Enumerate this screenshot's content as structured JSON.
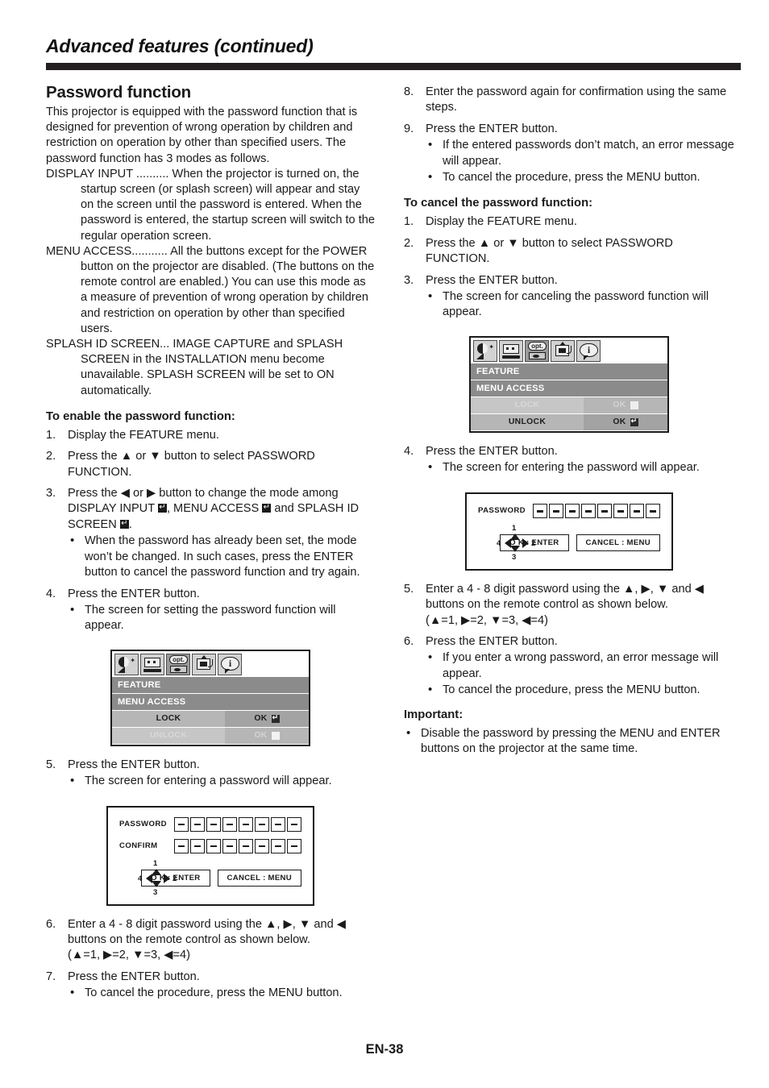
{
  "header": {
    "title": "Advanced features (continued)"
  },
  "left": {
    "section_title": "Password function",
    "intro": "This projector is equipped with the password function that is designed for prevention of wrong operation by children and restriction on operation by other than specified users. The password function has 3 modes as follows.",
    "modes": [
      {
        "lead": "DISPLAY INPUT ..........",
        "text": " When the projector is turned on, the startup screen (or splash screen) will appear and stay on the screen until the password is entered. When the password is entered, the startup screen will switch to the regular operation screen."
      },
      {
        "lead": "MENU ACCESS...........",
        "text": " All the buttons except for the POWER button on the projector are disabled. (The buttons on the remote control are enabled.) You can use this mode as a measure of prevention of wrong operation by children and restriction on operation by other than specified users."
      },
      {
        "lead": "SPLASH ID SCREEN...",
        "text": " IMAGE CAPTURE and SPLASH SCREEN in the INSTALLATION menu become unavailable. SPLASH SCREEN will be set to ON automatically."
      }
    ],
    "enable_title": "To enable the password function:",
    "steps": [
      {
        "num": "1.",
        "text": "Display the FEATURE menu."
      },
      {
        "num": "2.",
        "text": "Press the ▲ or ▼ button to select PASSWORD FUNCTION."
      },
      {
        "num": "3.",
        "text_a": "Press the ◀ or ▶ button to change the mode among DISPLAY INPUT ",
        "text_b": ", MENU ACCESS ",
        "text_c": " and SPLASH ID SCREEN ",
        "text_d": ".",
        "bullets": [
          "When the password has already been set, the mode won’t be changed. In such cases, press the ENTER button to cancel the password function and try again."
        ]
      },
      {
        "num": "4.",
        "text": "Press the ENTER button.",
        "bullets": [
          "The screen for setting the password function will appear."
        ]
      },
      {
        "num": "5.",
        "text": "Press the ENTER button.",
        "bullets": [
          "The screen for entering a password will appear."
        ]
      },
      {
        "num": "6.",
        "text": "Enter a 4 - 8 digit password using the ▲, ▶, ▼ and ◀ buttons on the remote control as shown below.",
        "sub": "(▲=1, ▶=2, ▼=3, ◀=4)"
      },
      {
        "num": "7.",
        "text": "Press the ENTER button.",
        "bullets": [
          "To cancel the procedure, press the MENU button."
        ]
      }
    ],
    "osd": {
      "tabs": [
        "image-tab",
        "video-tab",
        "opt-tab",
        "installation-tab",
        "info-tab"
      ],
      "opt_label": "opt.",
      "info_label": "i",
      "rows": [
        "FEATURE",
        "MENU ACCESS"
      ],
      "lock_label": "LOCK",
      "unlock_label": "UNLOCK",
      "ok_label": "OK",
      "active": "LOCK"
    },
    "password_fig": {
      "password_label": "PASSWORD",
      "confirm_label": "CONFIRM",
      "cells": 8,
      "dpad": {
        "up": "1",
        "right": "2",
        "down": "3",
        "left": "4"
      },
      "ok_button": "O K : ENTER",
      "cancel_button": "CANCEL : MENU"
    }
  },
  "right": {
    "steps_top": [
      {
        "num": "8.",
        "text": "Enter the password again for confirmation using the same steps."
      },
      {
        "num": "9.",
        "text": "Press the ENTER button.",
        "bullets": [
          "If the entered passwords don’t match, an error message will appear.",
          "To cancel the procedure, press the MENU button."
        ]
      }
    ],
    "cancel_title": "To cancel the password function:",
    "steps": [
      {
        "num": "1.",
        "text": "Display the FEATURE menu."
      },
      {
        "num": "2.",
        "text": "Press the ▲ or ▼ button to select PASSWORD FUNCTION."
      },
      {
        "num": "3.",
        "text": "Press the ENTER button.",
        "bullets": [
          "The screen for canceling the password function will appear."
        ]
      },
      {
        "num": "4.",
        "text": "Press the ENTER button.",
        "bullets": [
          "The screen for entering the password will appear."
        ]
      },
      {
        "num": "5.",
        "text": "Enter a 4 - 8 digit password using the ▲, ▶, ▼ and ◀ buttons on the remote control as shown below.",
        "sub": "(▲=1, ▶=2, ▼=3, ◀=4)"
      },
      {
        "num": "6.",
        "text": "Press the ENTER button.",
        "bullets": [
          "If you enter a wrong password, an error message will appear.",
          "To cancel the procedure, press the MENU button."
        ]
      }
    ],
    "important_title": "Important:",
    "important_bullets": [
      "Disable the password by pressing the MENU and ENTER buttons on the projector at the same time."
    ],
    "osd": {
      "tabs": [
        "image-tab",
        "video-tab",
        "opt-tab",
        "installation-tab",
        "info-tab"
      ],
      "opt_label": "opt.",
      "info_label": "i",
      "rows": [
        "FEATURE",
        "MENU ACCESS"
      ],
      "lock_label": "LOCK",
      "unlock_label": "UNLOCK",
      "ok_label": "OK",
      "active": "UNLOCK"
    },
    "password_fig": {
      "password_label": "PASSWORD",
      "cells": 8,
      "dpad": {
        "up": "1",
        "right": "2",
        "down": "3",
        "left": "4"
      },
      "ok_button": "O K : ENTER",
      "cancel_button": "CANCEL : MENU"
    }
  },
  "footer": {
    "page_number": "EN-38"
  },
  "colors": {
    "rule": "#231f20",
    "osd_header": "#8b8b8b",
    "osd_active_left": "#b6b6b6",
    "osd_active_right": "#a3a3a3",
    "osd_inactive_left": "#c6c6c6",
    "osd_inactive_right": "#b6b6b6"
  }
}
